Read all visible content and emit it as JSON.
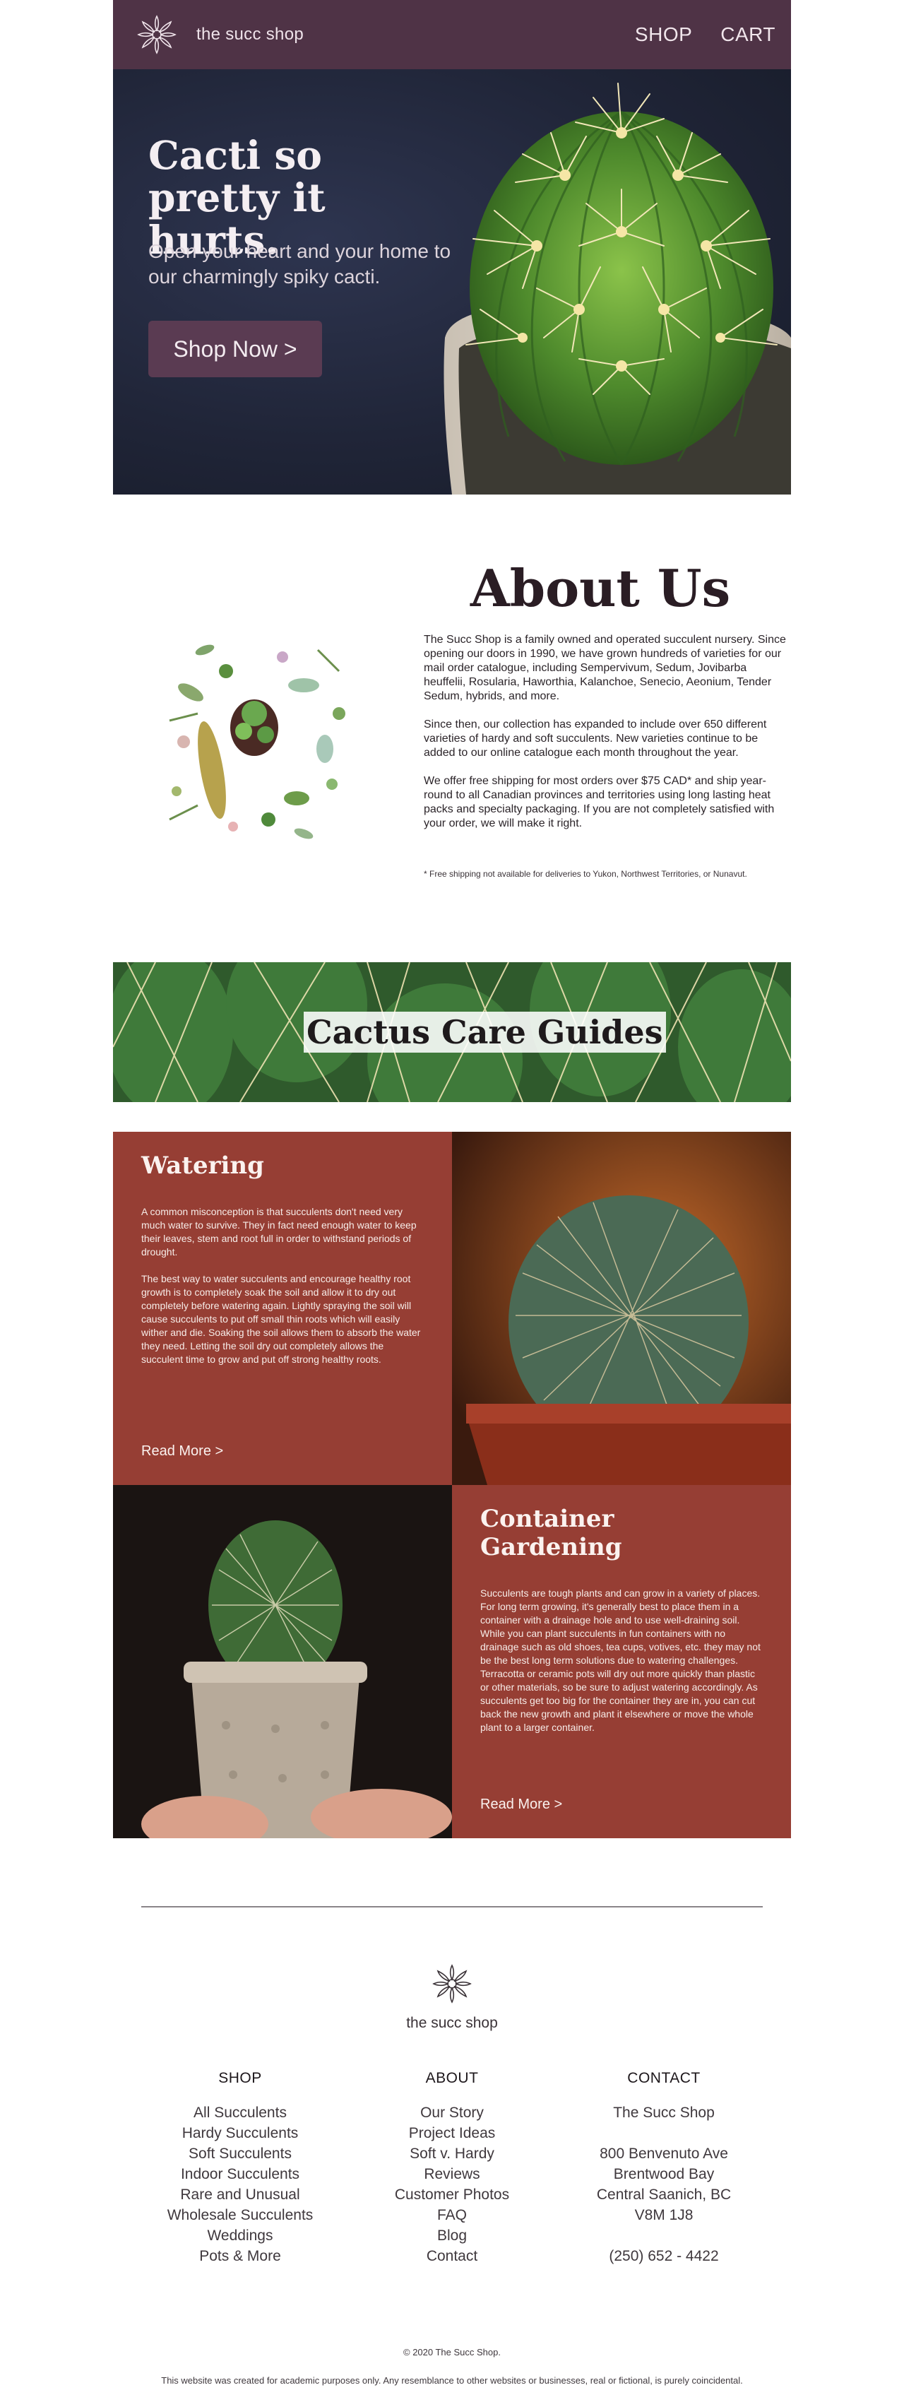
{
  "header": {
    "brand": "the succ shop",
    "nav": {
      "shop": "SHOP",
      "cart": "CART"
    }
  },
  "hero": {
    "title": "Cacti so pretty it hurts.",
    "subtitle": "Open your heart and your home to our charmingly spiky cacti.",
    "button": "Shop Now  >"
  },
  "about": {
    "title": "About Us",
    "paragraphs": [
      "The Succ Shop is a family owned and operated succulent nursery. Since opening our doors in 1990, we have grown hundreds of varieties for our mail order catalogue, including Sempervivum, Sedum, Jovibarba heuffelii, Rosularia, Haworthia, Kalanchoe, Senecio, Aeonium, Tender Sedum, hybrids, and more.",
      "Since then, our collection has expanded to include over 650 different varieties of hardy and soft succulents. New varieties continue to be added to our online catalogue each month throughout the year.",
      "We offer free shipping for most orders over $75 CAD* and ship year-round to all Canadian provinces and territories using long lasting heat packs and specialty packaging. If you are not completely satisfied with your order, we will make it right."
    ],
    "note": "* Free shipping not available for deliveries to Yukon, Northwest Territories, or Nunavut."
  },
  "guides": {
    "title": "Cactus Care Guides",
    "watering": {
      "title": "Watering",
      "paragraphs": [
        "A common misconception is that succulents don't need very much water to survive. They in fact need enough water to keep their leaves, stem and root full in order to withstand periods of drought.",
        "The best way to water succulents and encourage healthy root growth is to completely soak the soil and allow it to dry out completely before watering again. Lightly spraying the soil will cause succulents to put off small thin roots which will easily wither and die. Soaking the soil allows them to absorb the water they need. Letting the soil dry out completely allows the succulent time to grow and put off strong healthy roots."
      ],
      "read_more": "Read More  >"
    },
    "container": {
      "title": "Container Gardening",
      "paragraphs": [
        "Succulents are tough plants and can grow in a variety of places. For long term growing, it's generally best to place them in a container with a drainage hole and to use well-draining soil. While you can plant succulents in fun containers with no drainage such as old shoes, tea cups, votives, etc. they may not be the best long term solutions due to watering challenges. Terracotta or ceramic pots will dry out more quickly than plastic or other materials, so be sure to adjust watering accordingly. As succulents get too big for the container they are in, you can cut back the new growth and plant it elsewhere or move the whole plant to a larger container."
      ],
      "read_more": "Read More  >"
    }
  },
  "footer": {
    "brand": "the succ shop",
    "shop": {
      "heading": "SHOP",
      "items": [
        "All Succulents",
        "Hardy Succulents",
        "Soft Succulents",
        "Indoor Succulents",
        "Rare and Unusual",
        "Wholesale Succulents",
        "Weddings",
        "Pots & More"
      ]
    },
    "about": {
      "heading": "ABOUT",
      "items": [
        "Our Story",
        "Project Ideas",
        "Soft v. Hardy",
        "Reviews",
        "Customer Photos",
        "FAQ",
        "Blog",
        "Contact"
      ]
    },
    "contact": {
      "heading": "CONTACT",
      "name": "The Succ Shop",
      "address": [
        "800 Benvenuto Ave",
        "Brentwood Bay",
        "Central Saanich, BC",
        "V8M 1J8"
      ],
      "phone": "(250) 652 - 4422"
    },
    "copyright": "© 2020 The Succ Shop.",
    "disclaimer": "This website was created for academic purposes only. Any resemblance to other websites or businesses, real or fictional, is purely coincidental."
  },
  "colors": {
    "header_bg": "#4f3346",
    "hero_bg": "#202538",
    "guide_red": "#963e34",
    "button": "#5a3b52"
  }
}
